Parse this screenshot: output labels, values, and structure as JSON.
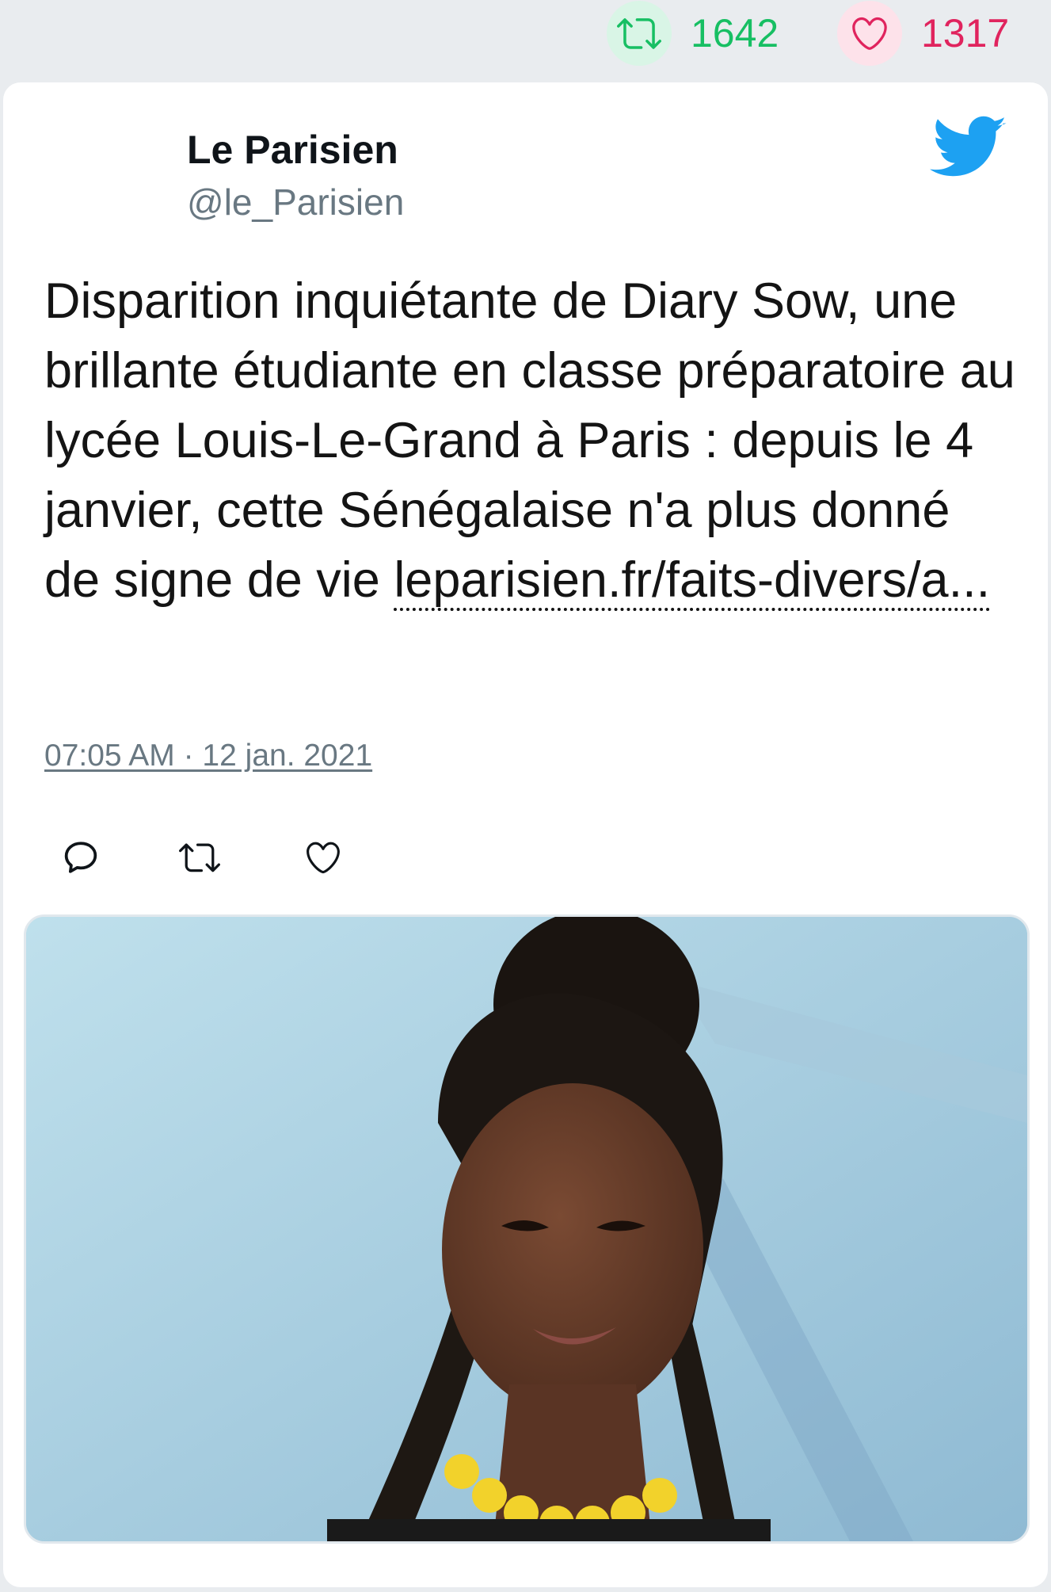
{
  "stats": {
    "retweet_count": "1642",
    "like_count": "1317",
    "retweet_color": "#17bf63",
    "like_color": "#e0245e"
  },
  "tweet": {
    "author_name": "Le Parisien",
    "author_handle": "@le_Parisien",
    "text": "Disparition inquiétante de Diary Sow, une brillante étudiante en classe préparatoire au lycée Louis-Le-Grand à Paris : depuis le 4 janvier, cette Sénégalaise n'a plus donné de signe de vie",
    "link_text": "leparisien.fr/faits-divers/a...",
    "timestamp": "07:05 AM · 12 jan. 2021"
  },
  "icons": {
    "retweet": "retweet-icon",
    "like": "heart-icon",
    "reply": "reply-icon",
    "brand": "twitter-bird-icon"
  },
  "brand_color": "#1da1f2"
}
